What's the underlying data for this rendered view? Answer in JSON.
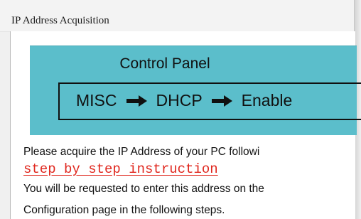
{
  "window": {
    "title": "IP Address Acquisition"
  },
  "panel": {
    "title": "Control Panel",
    "steps": [
      "MISC",
      "DHCP",
      "Enable"
    ],
    "color": "#5bbecb"
  },
  "body": {
    "line1": "Please acquire the IP Address of your PC followi",
    "link": "step by step instruction",
    "line3": "You will be requested to enter this address on the",
    "line4": "Configuration page in the following steps."
  },
  "colors": {
    "link": "#e0271e"
  }
}
